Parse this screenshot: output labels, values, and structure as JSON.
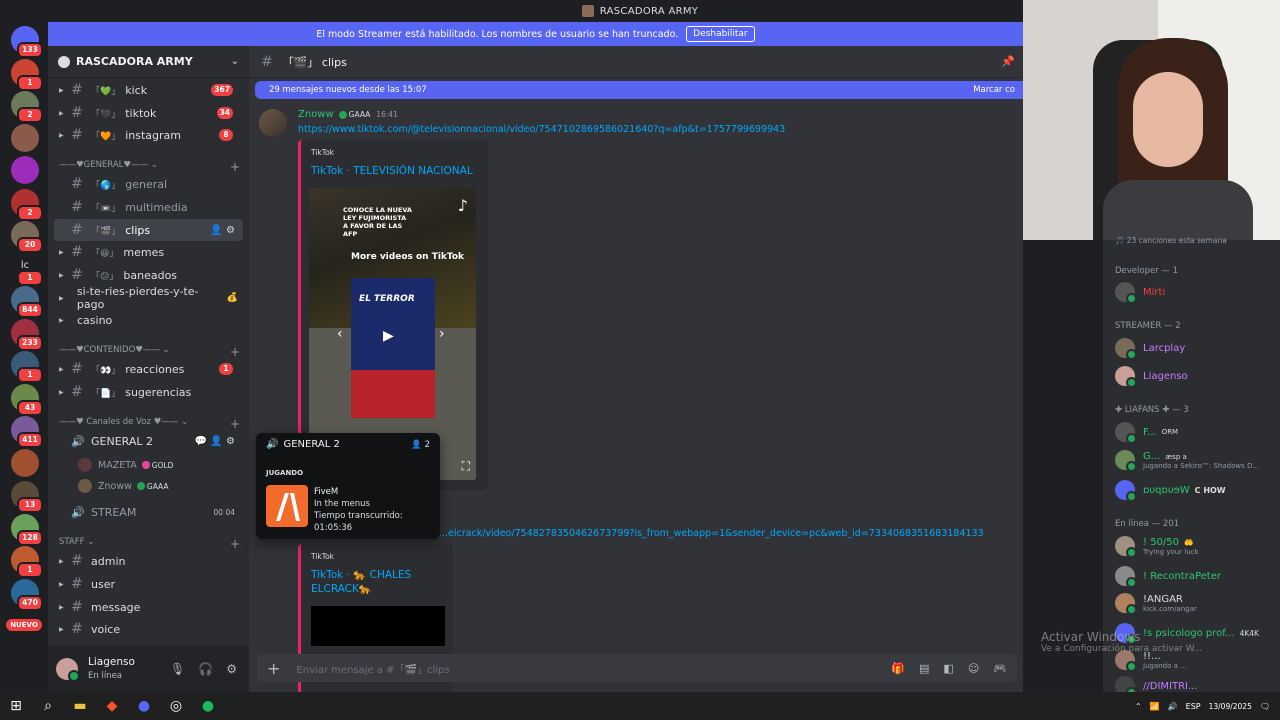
{
  "window": {
    "title": "RASCADORA ARMY"
  },
  "streamer_banner": {
    "text": "El modo Streamer está habilitado. Los nombres de usuario se han truncado.",
    "button": "Deshabilitar"
  },
  "servers": [
    {
      "badge": "133"
    },
    {
      "badge": "1"
    },
    {
      "badge": "2"
    },
    {
      "badge": ""
    },
    {
      "badge": ""
    },
    {
      "badge": "2"
    },
    {
      "badge": "20"
    },
    {
      "badge": "1",
      "text": "lc"
    },
    {
      "badge": "844"
    },
    {
      "badge": "233"
    },
    {
      "badge": "1"
    },
    {
      "badge": "43"
    },
    {
      "badge": "411"
    },
    {
      "badge": ""
    },
    {
      "badge": "13"
    },
    {
      "badge": "128"
    },
    {
      "badge": "1"
    },
    {
      "badge": "470"
    }
  ],
  "new_badge": "NUEVO",
  "server_name": "RASCADORA ARMY",
  "channels": {
    "kick": {
      "name": "kick",
      "prefix": "「💚」",
      "badge": "367"
    },
    "tiktok": {
      "name": "tiktok",
      "prefix": "「🖤」",
      "badge": "34"
    },
    "instagram": {
      "name": "instagram",
      "prefix": "「🧡」",
      "badge": "8"
    },
    "cat_general": "——♥GENERAL♥—— ⌄",
    "general": {
      "name": "general",
      "prefix": "「🌎」"
    },
    "multimedia": {
      "name": "multimedia",
      "prefix": "「📼」"
    },
    "clips": {
      "name": "clips",
      "prefix": "「🎬」"
    },
    "memes": {
      "name": "memes",
      "prefix": "「😆」"
    },
    "baneados": {
      "name": "baneados",
      "prefix": "「😕」"
    },
    "sitereis": {
      "name": "si-te-ries-pierdes-y-te-pago",
      "suffix": "💰"
    },
    "casino": {
      "name": "casino"
    },
    "cat_contenido": "——♥CONTENIDO♥—— ⌄",
    "reacciones": {
      "name": "reacciones",
      "prefix": "「👀」",
      "badge": "1"
    },
    "sugerencias": {
      "name": "sugerencias",
      "prefix": "「📄」"
    },
    "cat_voz": "——♥ Canales de Voz ♥—— ⌄",
    "general_voice": {
      "name": "GENERAL 2"
    },
    "voice_users": [
      {
        "name": "MAZETA",
        "tag": "GOLD",
        "tag_color": "#eb459e"
      },
      {
        "name": "Znoww",
        "tag": "GAAA",
        "tag_color": "#23a55a"
      }
    ],
    "stream": {
      "name": "STREAM",
      "count_a": "00",
      "count_b": "04"
    },
    "cat_staff": "STAFF ⌄",
    "admin": {
      "name": "admin"
    },
    "user": {
      "name": "user"
    },
    "message": {
      "name": "message"
    },
    "voice": {
      "name": "voice"
    }
  },
  "user_panel": {
    "name": "Liagenso",
    "status": "En línea"
  },
  "header": {
    "channel": "「🎬」 clips"
  },
  "new_messages": {
    "text": "29 mensajes nuevos desde las 15:07",
    "mark": "Marcar co"
  },
  "message1": {
    "author": "Znoww",
    "tag": "GAAA",
    "time": "16:41",
    "link": "https://www.tiktok.com/@televisionnacional/video/7547102869586021640?q=afp&t=1757799699943",
    "embed": {
      "provider": "TikTok",
      "title": "TikTok · TELEVISIÓN NACIONAL"
    },
    "video": {
      "more": "More videos on TikTok",
      "headline": "EL TERROR",
      "overlay": "CONOCE LA NUEVA LEY FUJIMORISTA A FAVOR DE LAS AFP"
    }
  },
  "message2": {
    "link": "...elcrack/video/7548278350462673799?is_from_webapp=1&sender_device=pc&web_id=7334068351683184133",
    "embed": {
      "provider": "TikTok",
      "title": "TikTok · 🐆 CHALES ELCRACK🐆"
    }
  },
  "voice_popup": {
    "channel": "GENERAL 2",
    "count": "2",
    "section": "JUGANDO",
    "game": "FiveM",
    "state": "In the menus",
    "elapsed": "Tiempo transcurrido: 01:05:36"
  },
  "composer": {
    "placeholder": "Enviar mensaje a #「🎬」clips"
  },
  "members": {
    "songs": "🎵 23 canciones esta semana",
    "dev_cat": "Developer — 1",
    "dev": [
      {
        "name": "Mirti",
        "color": "#f23f42"
      }
    ],
    "streamer_cat": "STREAMER — 2",
    "streamer": [
      {
        "name": "Larcplay",
        "color": "#c77dff"
      },
      {
        "name": "Liagenso",
        "color": "#c77dff"
      }
    ],
    "liafans_cat": "✚ LIAFANS ✚ — 3",
    "liafans": [
      {
        "name": "F...",
        "tag": "ORM",
        "sub": ""
      },
      {
        "name": "G...",
        "tag": "æsp a",
        "sub": "Jugando a Sekiro™: Shadows D..."
      },
      {
        "name": "ɒυqɒυɘW",
        "tag": "C HOW",
        "sub": ""
      }
    ],
    "online_cat": "En línea — 201",
    "online": [
      {
        "name": "! 50/50",
        "tag": "🤲",
        "sub": "Trying your luck"
      },
      {
        "name": "! RecontraPeter",
        "tag": "",
        "sub": ""
      },
      {
        "name": "!ANGAR",
        "tag": "",
        "sub": "kick.com/angar"
      },
      {
        "name": "!s psicologo prof...",
        "tag": "4K4K",
        "sub": ""
      },
      {
        "name": "!!...",
        "tag": "",
        "sub": "Jugando a ..."
      },
      {
        "name": "//DIMITRI...",
        "tag": "",
        "sub": ""
      }
    ]
  },
  "watermark": {
    "title": "Activar Windows",
    "sub": "Ve a Configuración para activar W..."
  },
  "taskbar": {
    "lang": "ESP",
    "time": "13/09/2025"
  },
  "colors": {
    "blurple": "#5865f2",
    "bg": "#313338",
    "sidebar": "#2b2d31",
    "link": "#00a8fc",
    "green": "#23a55a",
    "red": "#f23f42"
  },
  "icons": [
    "server-icon",
    "chevron-down-icon",
    "hash-icon",
    "add-member-icon",
    "gear-icon",
    "speaker-icon",
    "mic-icon",
    "headphones-icon",
    "plus-icon",
    "gift-icon",
    "gif-icon",
    "sticker-icon",
    "emoji-icon",
    "apps-icon",
    "pin-icon",
    "fullscreen-icon",
    "tiktok-icon",
    "windows-icon",
    "search-icon",
    "explorer-icon",
    "brave-icon",
    "discord-icon",
    "obs-icon",
    "spotify-icon"
  ]
}
